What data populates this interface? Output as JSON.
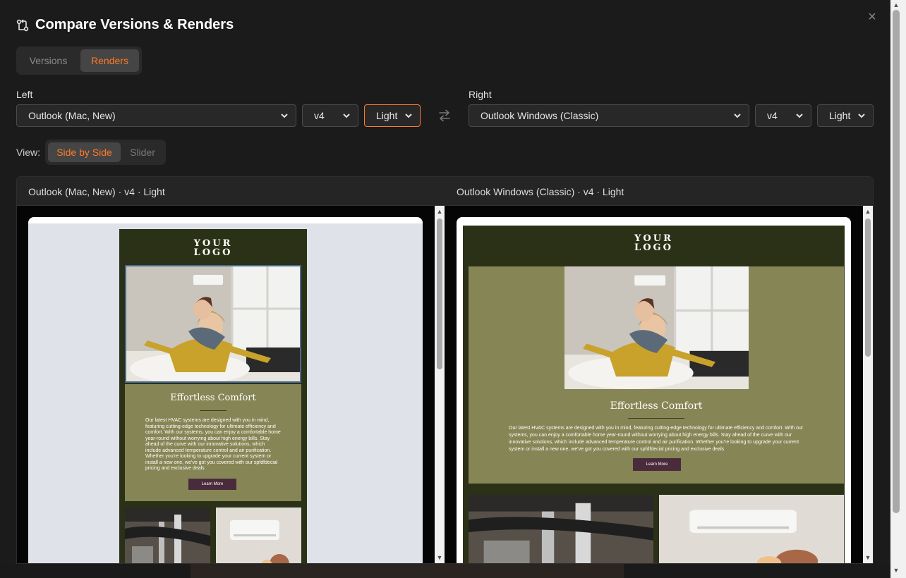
{
  "dialog": {
    "title": "Compare Versions & Renders",
    "close_label": "×"
  },
  "tabs": [
    {
      "label": "Versions",
      "active": false
    },
    {
      "label": "Renders",
      "active": true
    }
  ],
  "left": {
    "label": "Left",
    "client": "Outlook (Mac, New)",
    "version": "v4",
    "theme": "Light"
  },
  "right": {
    "label": "Right",
    "client": "Outlook Windows (Classic)",
    "version": "v4",
    "theme": "Light"
  },
  "view": {
    "label": "View:",
    "options": [
      {
        "label": "Side by Side",
        "active": true
      },
      {
        "label": "Slider",
        "active": false
      }
    ]
  },
  "captions": {
    "left": "Outlook (Mac, New) · v4 · Light",
    "right": "Outlook Windows (Classic) · v4 · Light"
  },
  "email": {
    "logo_line1": "YOUR",
    "logo_line2": "LOGO",
    "heading": "Effortless Comfort",
    "body": "Our latest HVAC systems are designed with you in mind, featuring cutting-edge technology for ultimate efficiency and comfort. With our systems, you can enjoy a comfortable home year-round without worrying about high energy bills. Stay ahead of the curve with our innovative solutions, which include advanced temperature control and air purification. Whether you're looking to upgrade your current system or install a new one, we've got you covered with our spfdfdecial pricing and exclusive deals",
    "cta": "Learn More"
  },
  "colors": {
    "accent": "#ff7a29",
    "email_dark_green": "#2b3117",
    "email_olive": "#868555",
    "email_button": "#4a2b3b",
    "left_canvas": "#dfe2e9"
  },
  "icons": {
    "title_icon": "compare-icon",
    "swap": "swap-horizontal-icon",
    "close": "close-icon"
  }
}
